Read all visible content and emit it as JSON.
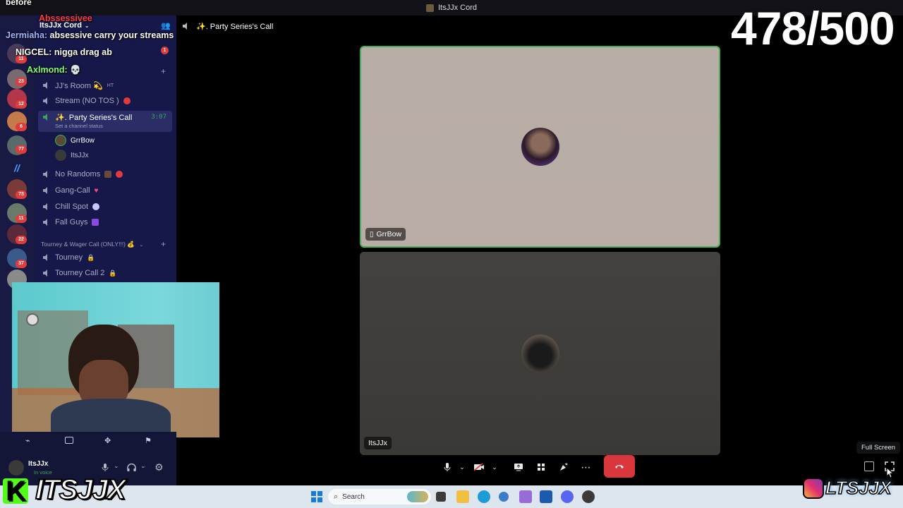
{
  "window": {
    "title": "ItsJJx Cord"
  },
  "overlay_chat": {
    "top_word": "before",
    "lines": [
      {
        "name": "Abssessivee",
        "name_color": "#ff3b3b",
        "message": ""
      },
      {
        "name": "Jermiaha:",
        "name_color": "#9fb7ff",
        "message": "absessive carry your streams"
      },
      {
        "name": "NIGCEL:",
        "name_color": "#ffffff",
        "message": "nigga drag ab"
      },
      {
        "name": "Axlmond:",
        "name_color": "#7cff6e",
        "message": "💀"
      }
    ]
  },
  "server": {
    "name": "ItsJJx Cord"
  },
  "server_rail": {
    "badges": [
      "11",
      "23",
      "12",
      "6",
      "77",
      "73",
      "11",
      "22",
      "37"
    ]
  },
  "sidebar": {
    "unread_badge": "1",
    "channels": [
      {
        "name": "JJ's Room 💫",
        "suffix": "HT"
      },
      {
        "name": "Stream (NO TOS )"
      },
      {
        "name": "✨. Party Series's Call",
        "timer": "3:07",
        "status": "Set a channel status"
      },
      {
        "name": "No Randoms"
      },
      {
        "name": "Gang-Call"
      },
      {
        "name": "Chill Spot"
      },
      {
        "name": "Fall Guys"
      },
      {
        "name": "Tourney"
      },
      {
        "name": "Tourney Call 2"
      }
    ],
    "voice_users": [
      "GrrBow",
      "ItsJJx"
    ],
    "category": "Tourney & Wager Call (ONLY!!!) 💰"
  },
  "channel_header": {
    "title": "✨. Party Series's Call"
  },
  "counter": {
    "text": "478/500"
  },
  "tiles": [
    {
      "name": "GrrBow",
      "speaking": true,
      "device": "phone"
    },
    {
      "name": "ItsJJx",
      "speaking": false
    }
  ],
  "tooltip": {
    "text": "Full Screen"
  },
  "user_panel": {
    "username": "ItsJJx",
    "status": "In voice"
  },
  "taskbar": {
    "search_placeholder": "Search"
  },
  "branding": {
    "left": "ITSJJX",
    "right": "LTSJJX"
  },
  "colors": {
    "rail": "#191a43",
    "sidebar": "#17184a",
    "speaking": "#3fb255",
    "hangup": "#da373c"
  }
}
